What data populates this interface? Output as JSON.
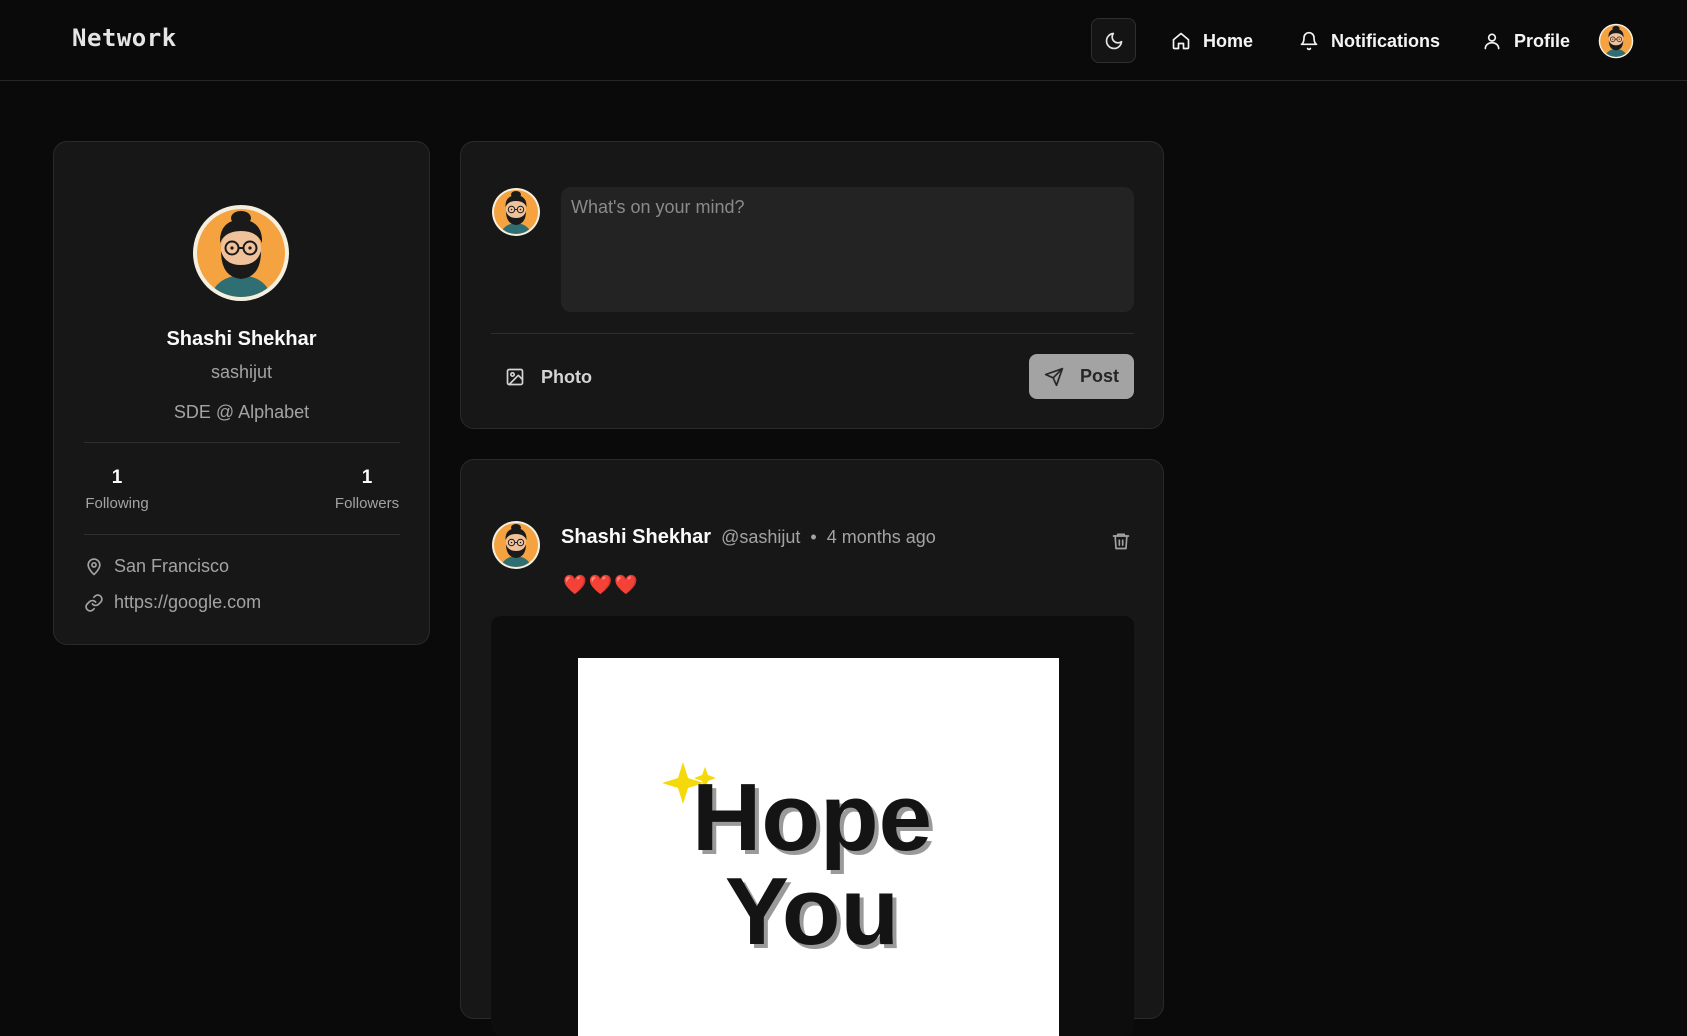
{
  "header": {
    "brand": "Network",
    "nav": {
      "home": "Home",
      "notifications": "Notifications",
      "profile": "Profile"
    },
    "icons": [
      "moon-icon",
      "home-icon",
      "bell-icon",
      "user-icon"
    ]
  },
  "profile_card": {
    "name": "Shashi Shekhar",
    "username": "sashijut",
    "bio": "SDE @ Alphabet",
    "stats": {
      "following_count": "1",
      "following_label": "Following",
      "followers_count": "1",
      "followers_label": "Followers"
    },
    "location": "San Francisco",
    "website": "https://google.com"
  },
  "composer": {
    "placeholder": "What's on your mind?",
    "photo_label": "Photo",
    "post_label": "Post"
  },
  "post": {
    "author": "Shashi Shekhar",
    "handle": "@sashijut",
    "separator": "•",
    "time": "4 months ago",
    "content": "❤️❤️❤️",
    "image_text": {
      "line1": "Hope",
      "line2": "You"
    }
  },
  "colors": {
    "background": "#0a0a0a",
    "card": "#171717",
    "border": "#2a2a2a",
    "muted_text": "#a3a3a3",
    "avatar_orange": "#f4a340",
    "post_button": "#a3a3a3"
  }
}
